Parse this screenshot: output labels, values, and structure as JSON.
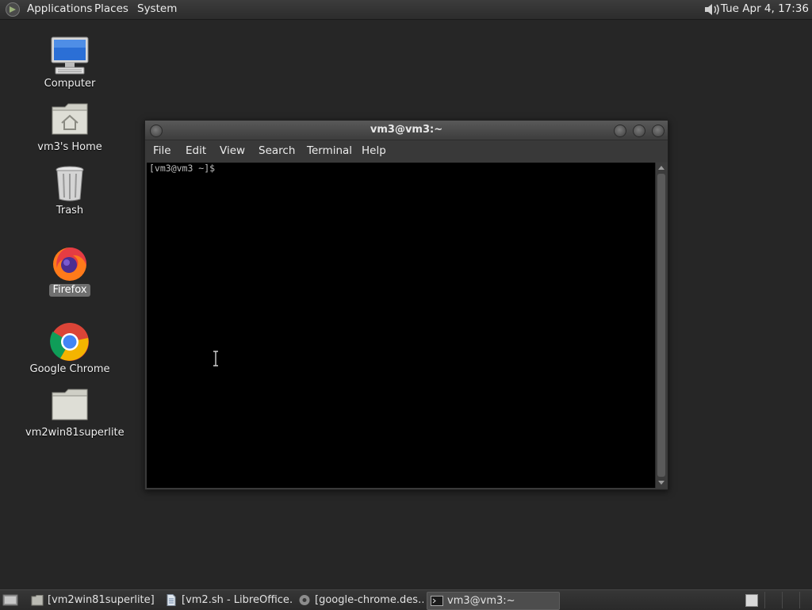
{
  "top_panel": {
    "menus": [
      "Applications",
      "Places",
      "System"
    ],
    "clock": "Tue Apr  4, 17:36",
    "icons": {
      "distro": "foot-logo-icon",
      "volume": "speaker-icon"
    }
  },
  "desktop": {
    "icons": [
      {
        "label": "Computer",
        "icon": "computer-monitor-icon"
      },
      {
        "label": "vm3's Home",
        "icon": "home-folder-icon"
      },
      {
        "label": "Trash",
        "icon": "trash-can-icon"
      },
      {
        "label": "Firefox",
        "icon": "firefox-icon",
        "selected": true
      },
      {
        "label": "Google Chrome",
        "icon": "chrome-icon"
      },
      {
        "label": "vm2win81superlite",
        "icon": "folder-icon"
      }
    ]
  },
  "terminal_window": {
    "title": "vm3@vm3:~",
    "menu": [
      "File",
      "Edit",
      "View",
      "Search",
      "Terminal",
      "Help"
    ],
    "prompt": "[vm3@vm3 ~]$"
  },
  "taskbar": {
    "tasks": [
      {
        "label": "[vm2win81superlite]",
        "icon": "folder-icon",
        "active": false
      },
      {
        "label": "[vm2.sh - LibreOffice…",
        "icon": "document-icon",
        "active": false
      },
      {
        "label": "[google-chrome.des…",
        "icon": "gear-icon",
        "active": false
      },
      {
        "label": "vm3@vm3:~",
        "icon": "terminal-icon",
        "active": true
      }
    ]
  },
  "colors": {
    "desktop_bg": "#262626",
    "panel_bg": "#333333",
    "terminal_bg": "#000000",
    "prompt_text": "#bdbdbd",
    "selected_label_bg": "#6f6f6f"
  }
}
